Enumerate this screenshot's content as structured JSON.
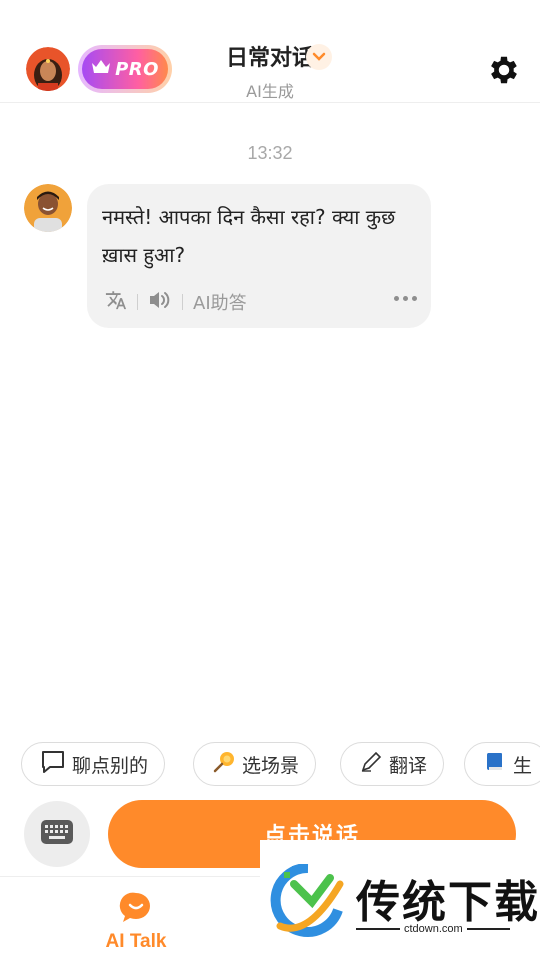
{
  "header": {
    "pro_label": "PRO",
    "title": "日常对话",
    "subtitle": "AI生成"
  },
  "chat": {
    "timestamp": "13:32",
    "messages": [
      {
        "text": "नमस्ते! आपका दिन कैसा रहा? क्या कुछ ख़ास हुआ?",
        "tools": {
          "ai_help_label": "AI助答"
        }
      }
    ]
  },
  "chips": [
    {
      "icon": "speech-bubble-icon",
      "label": "聊点别的"
    },
    {
      "icon": "lollipop-icon",
      "label": "选场景"
    },
    {
      "icon": "pen-icon",
      "label": "翻译"
    },
    {
      "icon": "book-icon",
      "label": "生"
    }
  ],
  "input": {
    "talk_label": "点击说话"
  },
  "nav": {
    "items": [
      {
        "label": "AI Talk",
        "icon": "chat-smile-icon",
        "active": true
      }
    ]
  },
  "watermark": {
    "brand": "传统下载",
    "url": "ctdown.com"
  },
  "colors": {
    "accent": "#ff8a2a",
    "bubble_bg": "#f2f2f2",
    "muted_text": "#9a9a9a"
  }
}
